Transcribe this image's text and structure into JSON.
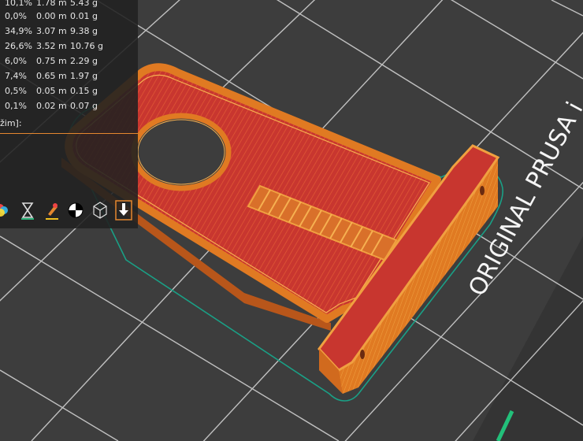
{
  "legend": {
    "rows": [
      {
        "pct": "10,1%",
        "len": "1.78 m",
        "weight": "5.43 g"
      },
      {
        "pct": "0,0%",
        "len": "0.00 m",
        "weight": "0.01 g"
      },
      {
        "pct": "34,9%",
        "len": "3.07 m",
        "weight": "9.38 g"
      },
      {
        "pct": "26,6%",
        "len": "3.52 m",
        "weight": "10.76 g"
      },
      {
        "pct": "6,0%",
        "len": "0.75 m",
        "weight": "2.29 g"
      },
      {
        "pct": "7,4%",
        "len": "0.65 m",
        "weight": "1.97 g"
      },
      {
        "pct": "0,5%",
        "len": "0.05 m",
        "weight": "0.15 g"
      },
      {
        "pct": "0,1%",
        "len": "0.02 m",
        "weight": "0.07 g"
      }
    ],
    "mode_label": "žim]:"
  },
  "toolbar": {
    "icons": [
      "color-print-icon",
      "hourglass-icon",
      "paint-brush-icon",
      "seam-icon",
      "wireframe-cube-icon",
      "export-icon"
    ]
  },
  "bed": {
    "text": "ORIGINAL PRUSA i"
  },
  "colors": {
    "accent": "#e4872f",
    "perimeter": "#e07020",
    "infill": "#cc3a32",
    "skirt": "#1aa086",
    "bed": "#3b3b3b",
    "grid": "#d8d8d8"
  }
}
